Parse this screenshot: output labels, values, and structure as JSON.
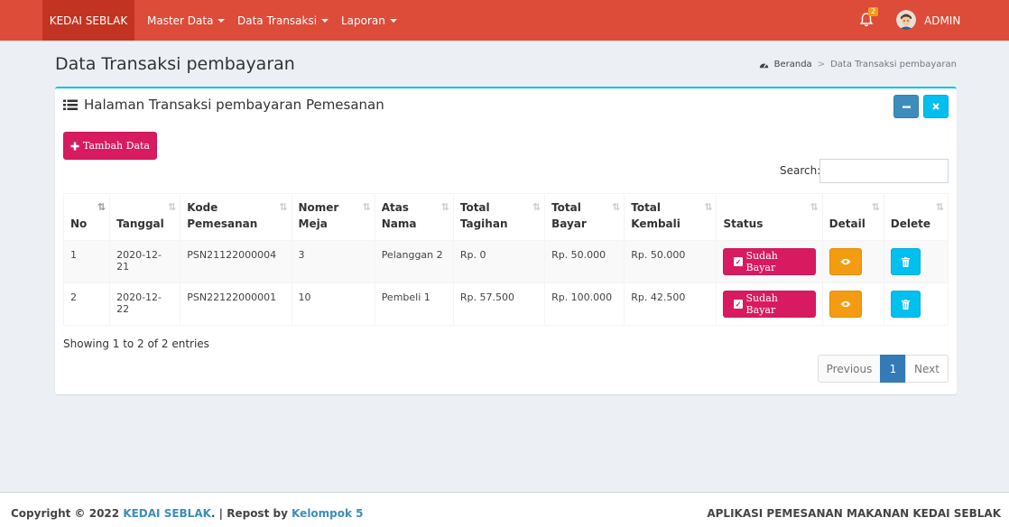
{
  "navbar": {
    "brand": "KEDAI SEBLAK",
    "menus": [
      {
        "label": "Master Data"
      },
      {
        "label": "Data Transaksi"
      },
      {
        "label": "Laporan"
      }
    ],
    "notification_count": "2",
    "user_name": "ADMIN",
    "bar_color": "#dd4b39"
  },
  "header": {
    "title": "Data Transaksi pembayaran",
    "breadcrumb": {
      "home": "Beranda",
      "current": "Data Transaksi pembayaran"
    }
  },
  "box": {
    "title": "Halaman Transaksi pembayaran Pemesanan",
    "add_button": "Tambah Data",
    "search_label": "Search:",
    "search_value": ""
  },
  "table": {
    "headers": {
      "no": "No",
      "tanggal": "Tanggal",
      "kode_1": "Kode",
      "kode_2": "Pemesanan",
      "meja_1": "Nomer",
      "meja_2": "Meja",
      "atas_1": "Atas",
      "atas_2": "Nama",
      "tagihan_1": "Total",
      "tagihan_2": "Tagihan",
      "bayar_1": "Total",
      "bayar_2": "Bayar",
      "kembali_1": "Total",
      "kembali_2": "Kembali",
      "status": "Status",
      "detail": "Detail",
      "delete": "Delete"
    },
    "rows": [
      {
        "no": "1",
        "tanggal": "2020-12-21",
        "kode": "PSN21122000004",
        "meja": "3",
        "atas_nama": "Pelanggan 2",
        "tagihan": "Rp. 0",
        "bayar": "Rp. 50.000",
        "kembali": "Rp. 50.000",
        "status": "Sudah Bayar"
      },
      {
        "no": "2",
        "tanggal": "2020-12-22",
        "kode": "PSN22122000001",
        "meja": "10",
        "atas_nama": "Pembeli 1",
        "tagihan": "Rp. 57.500",
        "bayar": "Rp. 100.000",
        "kembali": "Rp. 42.500",
        "status": "Sudah Bayar"
      }
    ]
  },
  "pagination": {
    "info": "Showing 1 to 2 of 2 entries",
    "previous": "Previous",
    "current": "1",
    "next": "Next"
  },
  "footer": {
    "copyright_prefix": "Copyright © 2022",
    "brand_link": "KEDAI SEBLAK",
    "repost_text": ". | Repost by",
    "group_link": "Kelompok 5",
    "app_name": "APLIKASI PEMESANAN MAKANAN KEDAI SEBLAK"
  }
}
